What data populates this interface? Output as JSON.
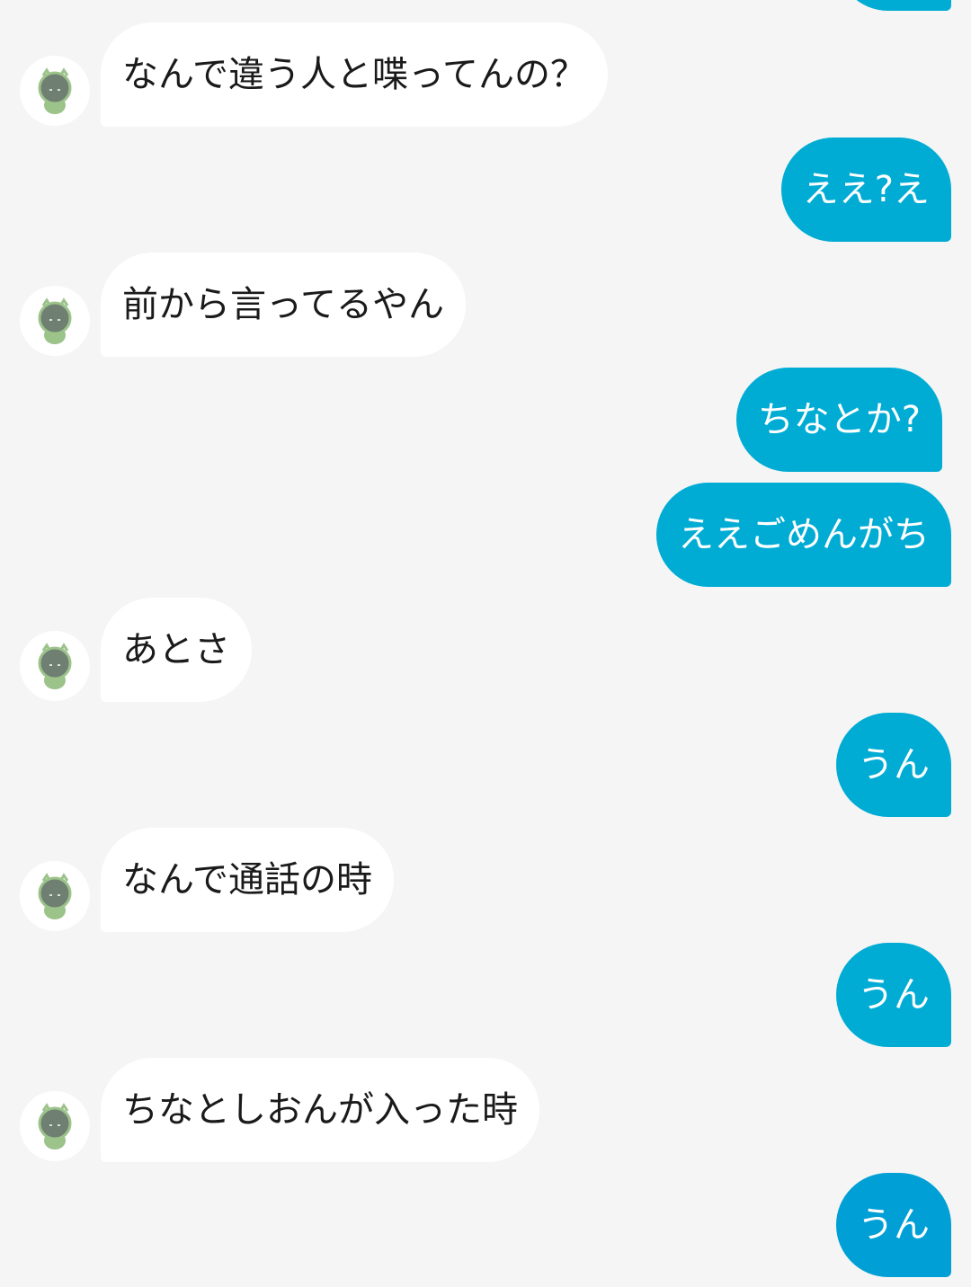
{
  "colors": {
    "incoming_bubble": "#ffffff",
    "outgoing_bubble": "#00acd4",
    "outgoing_bubble_last": "#009fd6",
    "background": "#f5f5f5",
    "incoming_text": "#1a1a1a",
    "outgoing_text": "#ffffff"
  },
  "messages": [
    {
      "from": "other",
      "text": "なんで違う人と喋ってんの？"
    },
    {
      "from": "me",
      "text": "ええ?え"
    },
    {
      "from": "other",
      "text": "前から言ってるやん"
    },
    {
      "from": "me",
      "text": "ちなとか?"
    },
    {
      "from": "me",
      "text": "ええごめんがち"
    },
    {
      "from": "other",
      "text": "あとさ"
    },
    {
      "from": "me",
      "text": "うん"
    },
    {
      "from": "other",
      "text": "なんで通話の時"
    },
    {
      "from": "me",
      "text": "うん"
    },
    {
      "from": "other",
      "text": "ちなとしおんが入った時"
    },
    {
      "from": "me",
      "text": "うん"
    }
  ],
  "avatar_icon": "green-dino-character-icon"
}
